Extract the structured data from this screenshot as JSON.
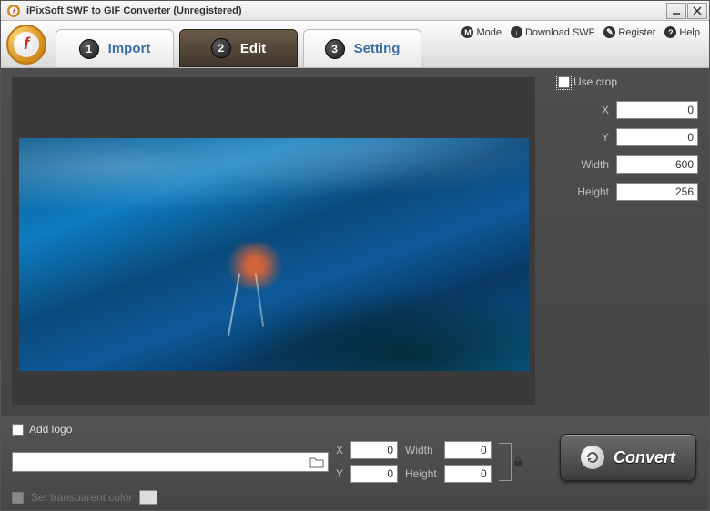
{
  "window": {
    "title": "iPixSoft SWF to GIF Converter (Unregistered)"
  },
  "tabs": [
    {
      "num": "1",
      "label": "Import"
    },
    {
      "num": "2",
      "label": "Edit"
    },
    {
      "num": "3",
      "label": "Setting"
    }
  ],
  "toolbar_links": {
    "mode": "Mode",
    "download": "Download SWF",
    "register": "Register",
    "help": "Help"
  },
  "crop": {
    "use_crop_label": "Use crop",
    "x_label": "X",
    "x_value": "0",
    "y_label": "Y",
    "y_value": "0",
    "width_label": "Width",
    "width_value": "600",
    "height_label": "Height",
    "height_value": "256"
  },
  "logo": {
    "add_logo_label": "Add logo",
    "path_value": "",
    "x_label": "X",
    "x_value": "0",
    "y_label": "Y",
    "y_value": "0",
    "width_label": "Width",
    "width_value": "0",
    "height_label": "Height",
    "height_value": "0",
    "transparent_label": "Set transparent color"
  },
  "convert": {
    "label": "Convert"
  },
  "toolbar_icons": {
    "mode": "M",
    "download": "↓",
    "register": "✎",
    "help": "?"
  }
}
